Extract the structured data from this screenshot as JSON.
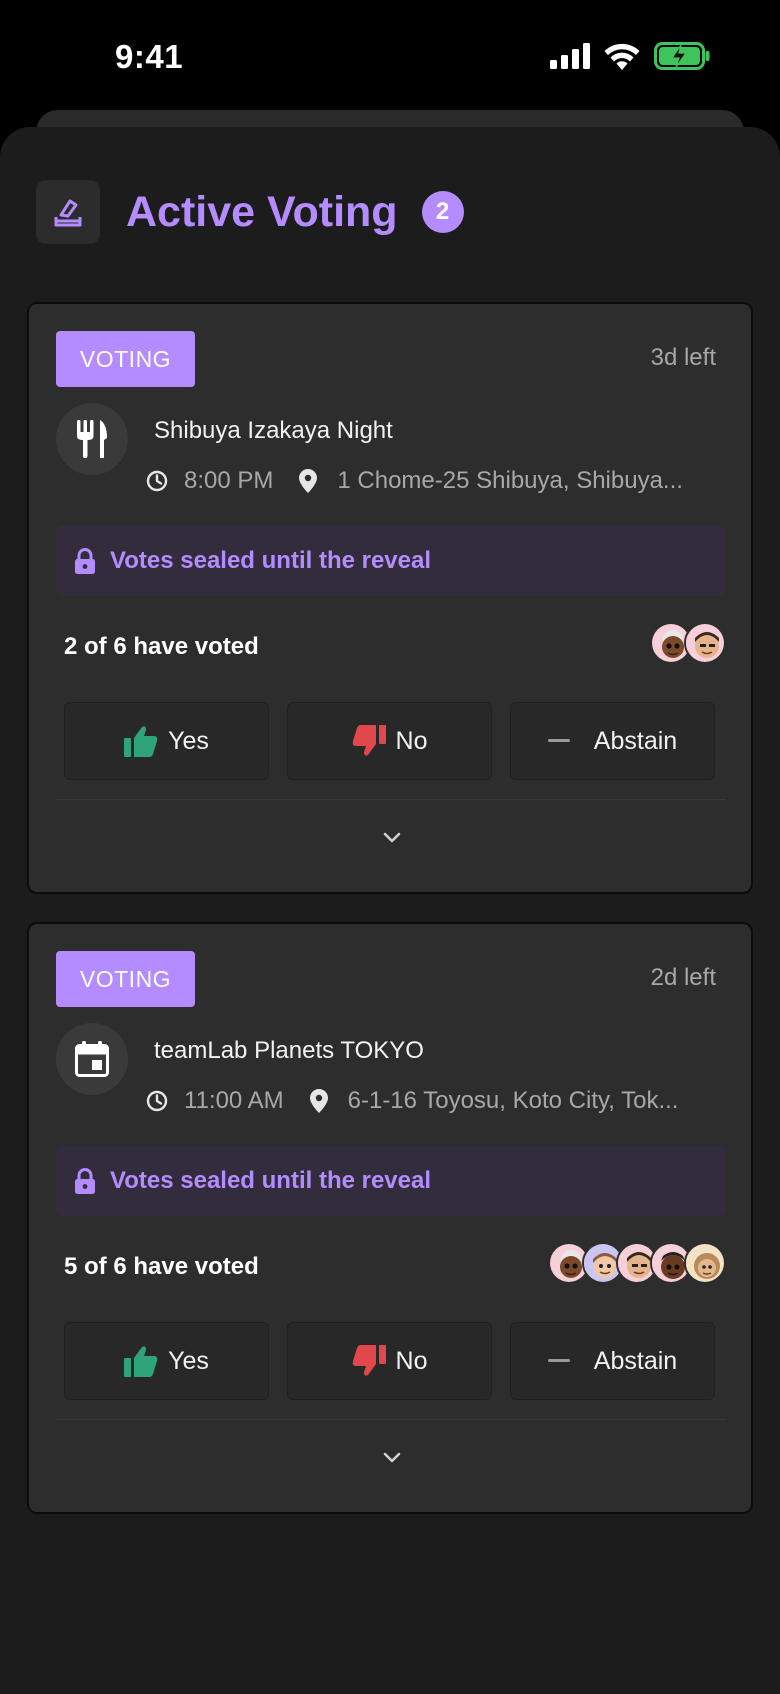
{
  "status_bar": {
    "time": "9:41"
  },
  "header": {
    "title": "Active Voting",
    "count": "2"
  },
  "cards": [
    {
      "badge": "VOTING",
      "time_left": "3d left",
      "icon": "utensils-icon",
      "title": "Shibuya Izakaya Night",
      "time": "8:00 PM",
      "location": "1 Chome-25 Shibuya, Shibuya...",
      "sealed": "Votes sealed until the reveal",
      "voted": "2 of 6 have voted",
      "avatar_count": 2,
      "yes": "Yes",
      "no": "No",
      "abstain": "Abstain"
    },
    {
      "badge": "VOTING",
      "time_left": "2d left",
      "icon": "calendar-icon",
      "title": "teamLab Planets TOKYO",
      "time": "11:00 AM",
      "location": "6-1-16 Toyosu, Koto City, Tok...",
      "sealed": "Votes sealed until the reveal",
      "voted": "5 of 6 have voted",
      "avatar_count": 5,
      "yes": "Yes",
      "no": "No",
      "abstain": "Abstain"
    }
  ],
  "colors": {
    "accent": "#b48cff",
    "yes": "#2fa47a",
    "no": "#e2474b",
    "sheet": "#1c1c1c",
    "card": "#2d2d2d"
  }
}
